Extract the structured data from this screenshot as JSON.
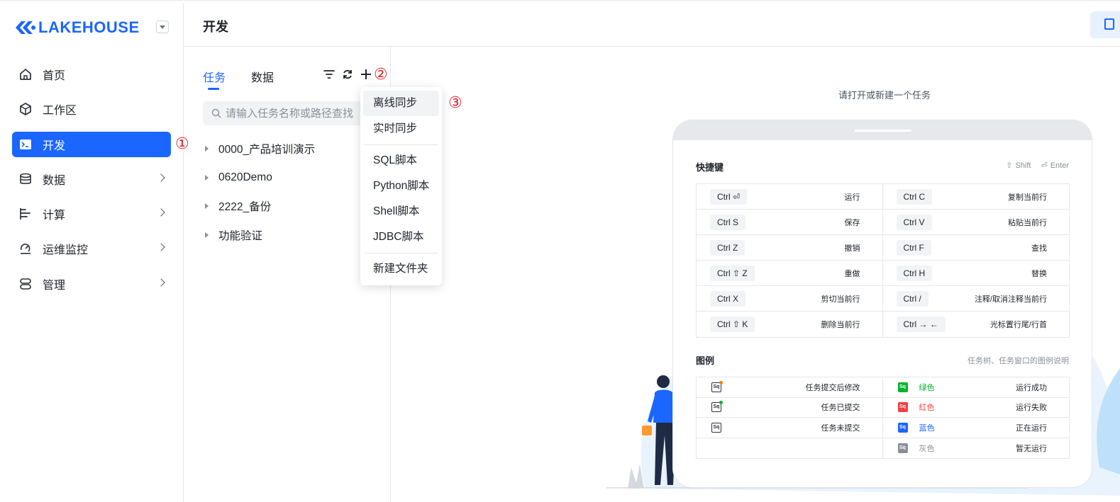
{
  "app": {
    "logo_text": "LAKEHOUSE"
  },
  "sidebar": {
    "items": [
      {
        "label": "首页",
        "icon": "home-icon",
        "has_children": false,
        "active": false
      },
      {
        "label": "工作区",
        "icon": "cube-icon",
        "has_children": false,
        "active": false
      },
      {
        "label": "开发",
        "icon": "terminal-icon",
        "has_children": false,
        "active": true
      },
      {
        "label": "数据",
        "icon": "database-icon",
        "has_children": true,
        "active": false
      },
      {
        "label": "计算",
        "icon": "bars-icon",
        "has_children": true,
        "active": false
      },
      {
        "label": "运维监控",
        "icon": "monitor-icon",
        "has_children": true,
        "active": false
      },
      {
        "label": "管理",
        "icon": "server-icon",
        "has_children": true,
        "active": false
      }
    ]
  },
  "annotations": {
    "m1": "①",
    "m2": "②",
    "m3": "③"
  },
  "header": {
    "title": "开发"
  },
  "panel": {
    "tabs": [
      {
        "label": "任务",
        "active": true
      },
      {
        "label": "数据",
        "active": false
      }
    ],
    "search_placeholder": "请输入任务名称或路径查找",
    "tree": [
      "0000_产品培训演示",
      "0620Demo",
      "2222_备份",
      "功能验证"
    ]
  },
  "add_menu": {
    "group1": [
      "离线同步",
      "实时同步"
    ],
    "group2": [
      "SQL脚本",
      "Python脚本",
      "Shell脚本",
      "JDBC脚本"
    ],
    "group3": [
      "新建文件夹"
    ]
  },
  "content": {
    "empty_hint": "请打开或新建一个任务",
    "shortcuts": {
      "title": "快捷键",
      "hint_shift": "Shift",
      "hint_enter": "Enter",
      "rows": [
        [
          {
            "keys": "Ctrl ⏎",
            "desc": "运行"
          },
          {
            "keys": "Ctrl  C",
            "desc": "复制当前行"
          }
        ],
        [
          {
            "keys": "Ctrl  S",
            "desc": "保存"
          },
          {
            "keys": "Ctrl  V",
            "desc": "粘贴当前行"
          }
        ],
        [
          {
            "keys": "Ctrl  Z",
            "desc": "撤销"
          },
          {
            "keys": "Ctrl  F",
            "desc": "查找"
          }
        ],
        [
          {
            "keys": "Ctrl ⇧ Z",
            "desc": "重做"
          },
          {
            "keys": "Ctrl  H",
            "desc": "替换"
          }
        ],
        [
          {
            "keys": "Ctrl  X",
            "desc": "剪切当前行"
          },
          {
            "keys": "Ctrl  /",
            "desc": "注释/取消注释当前行"
          }
        ],
        [
          {
            "keys": "Ctrl ⇧ K",
            "desc": "删除当前行"
          },
          {
            "keys": "Ctrl → ←",
            "desc": "光标置行尾/行首"
          }
        ]
      ]
    },
    "legend": {
      "title": "图例",
      "hint": "任务树、任务窗口的图例说明",
      "icon_text": "Sq",
      "left": [
        {
          "desc": "任务提交后修改",
          "dot": "#ff7d00"
        },
        {
          "desc": "任务已提交",
          "dot": "#00b42a"
        },
        {
          "desc": "任务未提交",
          "dot": ""
        },
        {
          "desc": "",
          "dot": ""
        }
      ],
      "right": [
        {
          "color_name": "绿色",
          "color": "#00b42a",
          "desc": "运行成功"
        },
        {
          "color_name": "红色",
          "color": "#f53f3f",
          "desc": "运行失败"
        },
        {
          "color_name": "蓝色",
          "color": "#1a66ff",
          "desc": "正在运行"
        },
        {
          "color_name": "灰色",
          "color": "#8a8f99",
          "desc": "暂无运行"
        }
      ]
    }
  },
  "colors": {
    "accent": "#1a66ff",
    "marker": "#e0242a"
  }
}
